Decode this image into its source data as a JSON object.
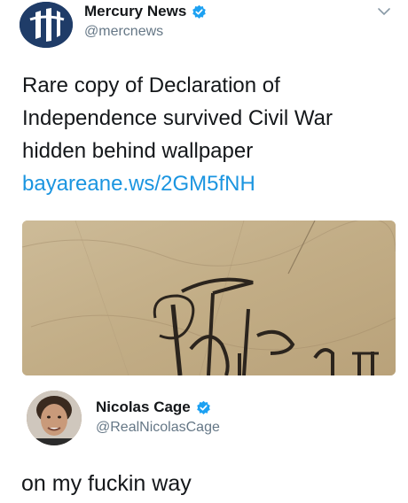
{
  "tweet": {
    "author_name": "Mercury News",
    "author_handle": "@mercnews",
    "text": "Rare copy of Declaration of Independence survived Civil War hidden behind wallpaper",
    "link": "bayareane.ws/2GM5fNH",
    "media_text": "The u",
    "icons": {
      "avatar": "mercury-news-logo",
      "verified": "verified-badge",
      "menu": "chevron-down-icon"
    },
    "colors": {
      "link": "#1b95e0",
      "verified": "#1da1f2",
      "handle": "#657786"
    }
  },
  "reply": {
    "author_name": "Nicolas Cage",
    "author_handle": "@RealNicolasCage",
    "text": "on my fuckin way"
  }
}
